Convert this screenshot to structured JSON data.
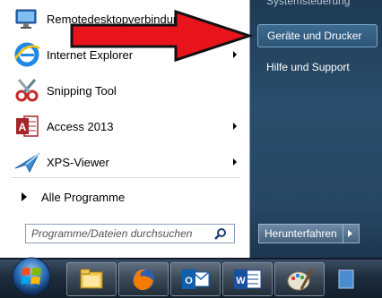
{
  "left_pane": {
    "programs": [
      {
        "label": "Remotedesktopverbindung",
        "icon": "remote-desktop-icon",
        "has_submenu": false
      },
      {
        "label": "Internet Explorer",
        "icon": "internet-explorer-icon",
        "has_submenu": true
      },
      {
        "label": "Snipping Tool",
        "icon": "scissors-icon",
        "has_submenu": false
      },
      {
        "label": "Access 2013",
        "icon": "access-icon",
        "has_submenu": true
      },
      {
        "label": "XPS-Viewer",
        "icon": "xps-viewer-icon",
        "has_submenu": true
      }
    ],
    "all_programs_label": "Alle Programme",
    "search_placeholder": "Programme/Dateien durchsuchen"
  },
  "right_pane": {
    "items": [
      {
        "label": "Systemsteuerung"
      },
      {
        "label": "Geräte und Drucker"
      },
      {
        "label": "Hilfe und Support"
      }
    ],
    "shutdown_label": "Herunterfahren"
  },
  "taskbar": {
    "buttons": [
      "start-orb",
      "explorer-icon",
      "firefox-icon",
      "outlook-icon",
      "word-icon",
      "paint-icon"
    ]
  },
  "colors": {
    "annotation_arrow": "#e8141c",
    "right_pane": "#2a4d6b",
    "taskbar": "#1d2c3d"
  }
}
